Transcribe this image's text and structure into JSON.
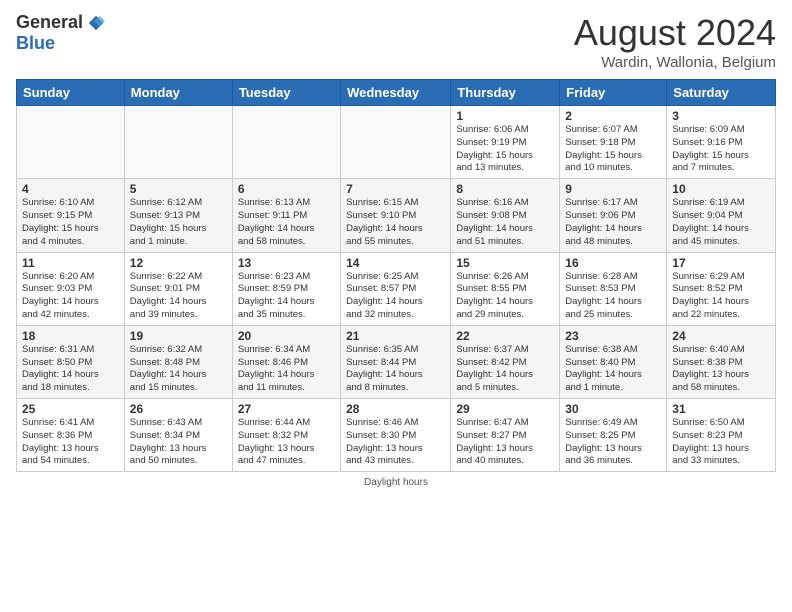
{
  "logo": {
    "general": "General",
    "blue": "Blue"
  },
  "title": "August 2024",
  "location": "Wardin, Wallonia, Belgium",
  "days_of_week": [
    "Sunday",
    "Monday",
    "Tuesday",
    "Wednesday",
    "Thursday",
    "Friday",
    "Saturday"
  ],
  "footer": "Daylight hours",
  "weeks": [
    [
      {
        "day": "",
        "info": ""
      },
      {
        "day": "",
        "info": ""
      },
      {
        "day": "",
        "info": ""
      },
      {
        "day": "",
        "info": ""
      },
      {
        "day": "1",
        "info": "Sunrise: 6:06 AM\nSunset: 9:19 PM\nDaylight: 15 hours\nand 13 minutes."
      },
      {
        "day": "2",
        "info": "Sunrise: 6:07 AM\nSunset: 9:18 PM\nDaylight: 15 hours\nand 10 minutes."
      },
      {
        "day": "3",
        "info": "Sunrise: 6:09 AM\nSunset: 9:16 PM\nDaylight: 15 hours\nand 7 minutes."
      }
    ],
    [
      {
        "day": "4",
        "info": "Sunrise: 6:10 AM\nSunset: 9:15 PM\nDaylight: 15 hours\nand 4 minutes."
      },
      {
        "day": "5",
        "info": "Sunrise: 6:12 AM\nSunset: 9:13 PM\nDaylight: 15 hours\nand 1 minute."
      },
      {
        "day": "6",
        "info": "Sunrise: 6:13 AM\nSunset: 9:11 PM\nDaylight: 14 hours\nand 58 minutes."
      },
      {
        "day": "7",
        "info": "Sunrise: 6:15 AM\nSunset: 9:10 PM\nDaylight: 14 hours\nand 55 minutes."
      },
      {
        "day": "8",
        "info": "Sunrise: 6:16 AM\nSunset: 9:08 PM\nDaylight: 14 hours\nand 51 minutes."
      },
      {
        "day": "9",
        "info": "Sunrise: 6:17 AM\nSunset: 9:06 PM\nDaylight: 14 hours\nand 48 minutes."
      },
      {
        "day": "10",
        "info": "Sunrise: 6:19 AM\nSunset: 9:04 PM\nDaylight: 14 hours\nand 45 minutes."
      }
    ],
    [
      {
        "day": "11",
        "info": "Sunrise: 6:20 AM\nSunset: 9:03 PM\nDaylight: 14 hours\nand 42 minutes."
      },
      {
        "day": "12",
        "info": "Sunrise: 6:22 AM\nSunset: 9:01 PM\nDaylight: 14 hours\nand 39 minutes."
      },
      {
        "day": "13",
        "info": "Sunrise: 6:23 AM\nSunset: 8:59 PM\nDaylight: 14 hours\nand 35 minutes."
      },
      {
        "day": "14",
        "info": "Sunrise: 6:25 AM\nSunset: 8:57 PM\nDaylight: 14 hours\nand 32 minutes."
      },
      {
        "day": "15",
        "info": "Sunrise: 6:26 AM\nSunset: 8:55 PM\nDaylight: 14 hours\nand 29 minutes."
      },
      {
        "day": "16",
        "info": "Sunrise: 6:28 AM\nSunset: 8:53 PM\nDaylight: 14 hours\nand 25 minutes."
      },
      {
        "day": "17",
        "info": "Sunrise: 6:29 AM\nSunset: 8:52 PM\nDaylight: 14 hours\nand 22 minutes."
      }
    ],
    [
      {
        "day": "18",
        "info": "Sunrise: 6:31 AM\nSunset: 8:50 PM\nDaylight: 14 hours\nand 18 minutes."
      },
      {
        "day": "19",
        "info": "Sunrise: 6:32 AM\nSunset: 8:48 PM\nDaylight: 14 hours\nand 15 minutes."
      },
      {
        "day": "20",
        "info": "Sunrise: 6:34 AM\nSunset: 8:46 PM\nDaylight: 14 hours\nand 11 minutes."
      },
      {
        "day": "21",
        "info": "Sunrise: 6:35 AM\nSunset: 8:44 PM\nDaylight: 14 hours\nand 8 minutes."
      },
      {
        "day": "22",
        "info": "Sunrise: 6:37 AM\nSunset: 8:42 PM\nDaylight: 14 hours\nand 5 minutes."
      },
      {
        "day": "23",
        "info": "Sunrise: 6:38 AM\nSunset: 8:40 PM\nDaylight: 14 hours\nand 1 minute."
      },
      {
        "day": "24",
        "info": "Sunrise: 6:40 AM\nSunset: 8:38 PM\nDaylight: 13 hours\nand 58 minutes."
      }
    ],
    [
      {
        "day": "25",
        "info": "Sunrise: 6:41 AM\nSunset: 8:36 PM\nDaylight: 13 hours\nand 54 minutes."
      },
      {
        "day": "26",
        "info": "Sunrise: 6:43 AM\nSunset: 8:34 PM\nDaylight: 13 hours\nand 50 minutes."
      },
      {
        "day": "27",
        "info": "Sunrise: 6:44 AM\nSunset: 8:32 PM\nDaylight: 13 hours\nand 47 minutes."
      },
      {
        "day": "28",
        "info": "Sunrise: 6:46 AM\nSunset: 8:30 PM\nDaylight: 13 hours\nand 43 minutes."
      },
      {
        "day": "29",
        "info": "Sunrise: 6:47 AM\nSunset: 8:27 PM\nDaylight: 13 hours\nand 40 minutes."
      },
      {
        "day": "30",
        "info": "Sunrise: 6:49 AM\nSunset: 8:25 PM\nDaylight: 13 hours\nand 36 minutes."
      },
      {
        "day": "31",
        "info": "Sunrise: 6:50 AM\nSunset: 8:23 PM\nDaylight: 13 hours\nand 33 minutes."
      }
    ]
  ]
}
